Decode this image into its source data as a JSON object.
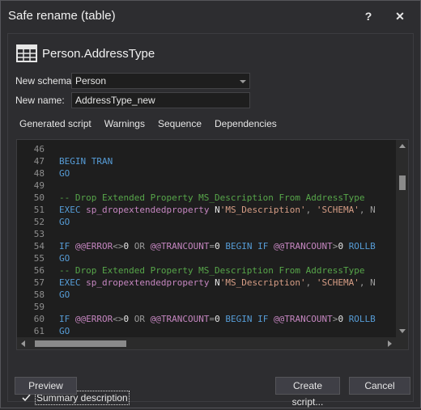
{
  "window": {
    "title": "Safe rename (table)",
    "help_label": "?",
    "close_label": "✕"
  },
  "heading": "Person.AddressType",
  "form": {
    "schema_label": "New schema:",
    "schema_value": "Person",
    "name_label": "New name:",
    "name_value": "AddressType_new"
  },
  "tabs": [
    "Generated script",
    "Warnings",
    "Sequence",
    "Dependencies"
  ],
  "line_numbers": [
    "46",
    "47",
    "48",
    "49",
    "50",
    "51",
    "52",
    "53",
    "54",
    "55",
    "56",
    "57",
    "58",
    "59",
    "60",
    "61"
  ],
  "code_lines": [
    [],
    [
      {
        "t": "BEGIN TRAN",
        "c": "kw"
      }
    ],
    [
      {
        "t": "GO",
        "c": "kw"
      }
    ],
    [],
    [
      {
        "t": "-- Drop Extended Property MS_Description From AddressType",
        "c": "cm"
      }
    ],
    [
      {
        "t": "EXEC ",
        "c": "kw"
      },
      {
        "t": "sp_dropextendedproperty ",
        "c": "fn"
      },
      {
        "t": "N",
        "c": ""
      },
      {
        "t": "'MS_Description'",
        "c": "st"
      },
      {
        "t": ", ",
        "c": "gr"
      },
      {
        "t": "'SCHEMA'",
        "c": "st"
      },
      {
        "t": ", N",
        "c": "gr"
      }
    ],
    [
      {
        "t": "GO",
        "c": "kw"
      }
    ],
    [],
    [
      {
        "t": "IF ",
        "c": "kw"
      },
      {
        "t": "@@ERROR",
        "c": "fn"
      },
      {
        "t": "<>",
        "c": "gr"
      },
      {
        "t": "0 ",
        "c": ""
      },
      {
        "t": "OR ",
        "c": "gr"
      },
      {
        "t": "@@TRANCOUNT",
        "c": "fn"
      },
      {
        "t": "=",
        "c": "gr"
      },
      {
        "t": "0 ",
        "c": ""
      },
      {
        "t": "BEGIN IF ",
        "c": "kw"
      },
      {
        "t": "@@TRANCOUNT",
        "c": "fn"
      },
      {
        "t": ">",
        "c": "gr"
      },
      {
        "t": "0 ",
        "c": ""
      },
      {
        "t": "ROLLB",
        "c": "kw"
      }
    ],
    [
      {
        "t": "GO",
        "c": "kw"
      }
    ],
    [
      {
        "t": "-- Drop Extended Property MS_Description From AddressType",
        "c": "cm"
      }
    ],
    [
      {
        "t": "EXEC ",
        "c": "kw"
      },
      {
        "t": "sp_dropextendedproperty ",
        "c": "fn"
      },
      {
        "t": "N",
        "c": ""
      },
      {
        "t": "'MS_Description'",
        "c": "st"
      },
      {
        "t": ", ",
        "c": "gr"
      },
      {
        "t": "'SCHEMA'",
        "c": "st"
      },
      {
        "t": ", N",
        "c": "gr"
      }
    ],
    [
      {
        "t": "GO",
        "c": "kw"
      }
    ],
    [],
    [
      {
        "t": "IF ",
        "c": "kw"
      },
      {
        "t": "@@ERROR",
        "c": "fn"
      },
      {
        "t": "<>",
        "c": "gr"
      },
      {
        "t": "0 ",
        "c": ""
      },
      {
        "t": "OR ",
        "c": "gr"
      },
      {
        "t": "@@TRANCOUNT",
        "c": "fn"
      },
      {
        "t": "=",
        "c": "gr"
      },
      {
        "t": "0 ",
        "c": ""
      },
      {
        "t": "BEGIN IF ",
        "c": "kw"
      },
      {
        "t": "@@TRANCOUNT",
        "c": "fn"
      },
      {
        "t": ">",
        "c": "gr"
      },
      {
        "t": "0 ",
        "c": ""
      },
      {
        "t": "ROLLB",
        "c": "kw"
      }
    ],
    [
      {
        "t": "GO",
        "c": "kw"
      }
    ]
  ],
  "summary": {
    "checked": true,
    "label": "Summary description"
  },
  "buttons": {
    "preview": "Preview",
    "create_script": "Create script...",
    "cancel": "Cancel"
  }
}
